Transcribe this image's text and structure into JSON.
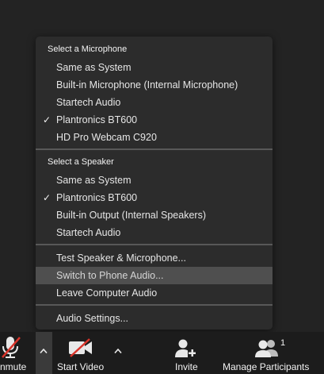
{
  "audio_menu": {
    "microphone_title": "Select a Microphone",
    "microphones": [
      {
        "label": "Same as System",
        "checked": false
      },
      {
        "label": "Built-in Microphone (Internal Microphone)",
        "checked": false
      },
      {
        "label": "Startech Audio",
        "checked": false
      },
      {
        "label": "Plantronics BT600",
        "checked": true
      },
      {
        "label": "HD Pro Webcam C920",
        "checked": false
      }
    ],
    "speaker_title": "Select a Speaker",
    "speakers": [
      {
        "label": "Same as System",
        "checked": false
      },
      {
        "label": "Plantronics BT600",
        "checked": true
      },
      {
        "label": "Built-in Output (Internal Speakers)",
        "checked": false
      },
      {
        "label": "Startech Audio",
        "checked": false
      }
    ],
    "checkmark": "✓",
    "actions": [
      {
        "label": "Test Speaker & Microphone...",
        "highlighted": false
      },
      {
        "label": "Switch to Phone Audio...",
        "highlighted": true
      },
      {
        "label": "Leave Computer Audio",
        "highlighted": false
      }
    ],
    "settings_label": "Audio Settings..."
  },
  "toolbar": {
    "unmute_label": "nmute",
    "start_video_label": "Start Video",
    "invite_label": "Invite",
    "manage_participants_label": "Manage Participants",
    "participant_count": "1"
  },
  "colors": {
    "background": "#232323",
    "menu_background": "#2c2c2c",
    "highlight": "#4f4f4f",
    "muted_red": "#d9342b"
  },
  "icons": {
    "unmute": "microphone-muted-icon",
    "start_video": "video-camera-off-icon",
    "invite": "person-add-icon",
    "participants": "people-icon",
    "caret": "chevron-up-icon"
  }
}
